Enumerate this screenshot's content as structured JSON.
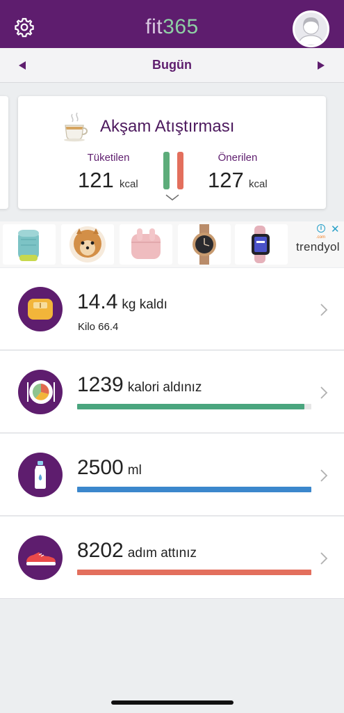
{
  "header": {
    "logo_fit": "fit",
    "logo_num": "365",
    "settings_icon": "gear-icon",
    "avatar_icon": "user-avatar-icon"
  },
  "date_nav": {
    "label": "Bugün",
    "prev_icon": "triangle-left-icon",
    "next_icon": "triangle-right-icon"
  },
  "meal": {
    "title": "Akşam Atıştırması",
    "consumed_label": "Tüketilen",
    "consumed_value": "121",
    "consumed_unit": "kcal",
    "suggested_label": "Önerilen",
    "suggested_value": "127",
    "suggested_unit": "kcal",
    "colors": {
      "consumed": "#5dac7a",
      "suggested": "#e36f5d"
    }
  },
  "ad": {
    "brand": "trendyol",
    "brand_sup": ".com",
    "items": [
      "speaker",
      "puppy",
      "earbuds",
      "watch",
      "fitness-band"
    ]
  },
  "rows": [
    {
      "value": "14.4",
      "suffix": "kg kaldı",
      "sub": "Kilo 66.4",
      "icon": "scale-icon"
    },
    {
      "value": "1239",
      "suffix": "kalori aldınız",
      "progress": 0.97,
      "color": "#4aa57e",
      "icon": "plate-icon"
    },
    {
      "value": "2500",
      "suffix": "ml",
      "progress": 1.0,
      "color": "#3b87cc",
      "icon": "water-bottle-icon"
    },
    {
      "value": "8202",
      "suffix": "adım attınız",
      "progress": 1.0,
      "color": "#e36f5d",
      "icon": "sneaker-icon"
    }
  ]
}
